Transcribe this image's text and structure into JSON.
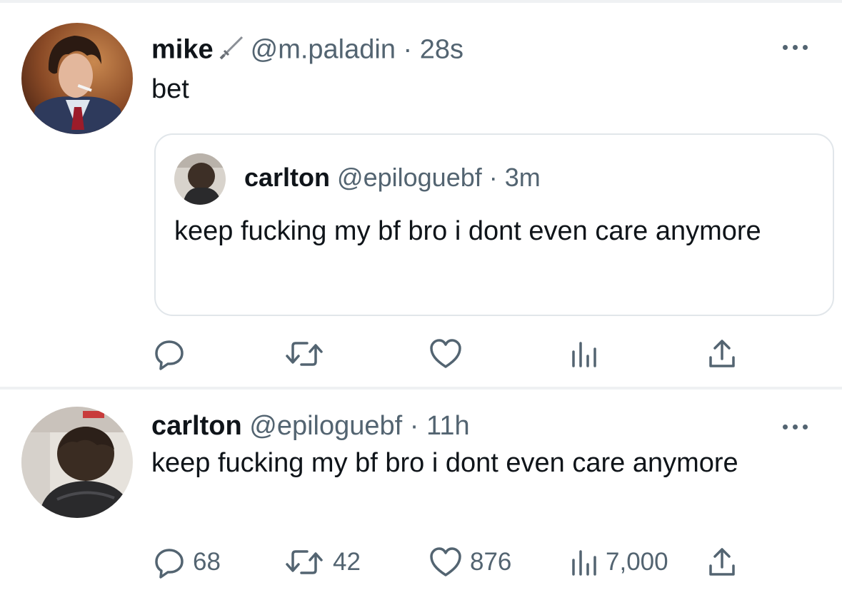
{
  "colors": {
    "text": "#0f1419",
    "muted": "#536471",
    "border": "#e1e6ea"
  },
  "tweets": [
    {
      "name": "mike",
      "badge_icon": "sword-icon",
      "handle": "@m.paladin",
      "dot": "·",
      "time": "28s",
      "text": "bet",
      "quote": {
        "name": "carlton",
        "handle": "@epiloguebf",
        "dot": "·",
        "time": "3m",
        "text": "keep fucking my bf bro i dont even care anymore"
      },
      "actions": {
        "reply": "",
        "retweet": "",
        "like": "",
        "views": ""
      }
    },
    {
      "name": "carlton",
      "handle": "@epiloguebf",
      "dot": "·",
      "time": "11h",
      "text": "keep fucking my bf bro i dont even care anymore",
      "actions": {
        "reply": "68",
        "retweet": "42",
        "like": "876",
        "views": "7,000"
      }
    }
  ]
}
